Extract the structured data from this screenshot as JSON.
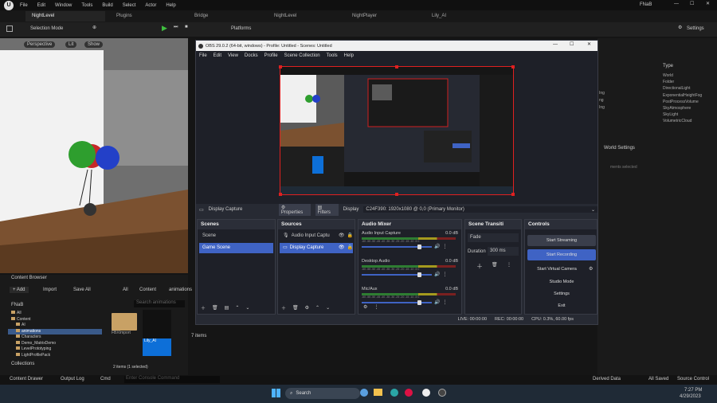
{
  "ue": {
    "menu": [
      "File",
      "Edit",
      "Window",
      "Tools",
      "Build",
      "Select",
      "Actor",
      "Help"
    ],
    "project": "FNaB",
    "tabs": [
      "NightLevel",
      "Plugins",
      "Bridge",
      "NightLevel",
      "NightPlayer",
      "Lily_AI"
    ],
    "toolbar": {
      "selection_mode": "Selection Mode",
      "platforms": "Platforms",
      "settings": "Settings"
    },
    "viewport": {
      "perspective": "Perspective",
      "lit": "Lit",
      "show": "Show"
    },
    "content_browser": {
      "title": "Content Browser",
      "add": "+ Add",
      "import": "Import",
      "save_all": "Save All",
      "path": [
        "All",
        "Content",
        "animations"
      ],
      "tree_root": "FNaB",
      "tree": [
        "All",
        "Content",
        "AI",
        "animations",
        "Characters",
        "Demo_MatrixDemo",
        "LevelPrototyping",
        "LightProfilePack"
      ],
      "filter_placeholder": "Search animations",
      "assets": [
        {
          "name": "FBXImport",
          "type": "folder"
        },
        {
          "name": "Lily_AI",
          "type": "asset"
        }
      ],
      "count": "2 items (1 selected)",
      "collections": "Collections"
    },
    "outliner": {
      "type_header": "Type",
      "types": [
        "World",
        "Folder",
        "DirectionalLight",
        "ExponentialHeightFog",
        "PostProcessVolume",
        "SkyAtmosphere",
        "SkyLight",
        "VolumetricCloud"
      ],
      "world_settings": "World Settings",
      "frag1": "Ing",
      "frag2": "ng",
      "frag3": "Ing",
      "frag4": "ments selected"
    },
    "status": {
      "drawer": "Content Drawer",
      "output_log": "Output Log",
      "cmd": "Cmd",
      "cmd_placeholder": "Enter Console Command",
      "derived_data": "Derived Data",
      "all_saved": "All Saved",
      "source_control": "Source Control"
    },
    "items": "7 items"
  },
  "obs": {
    "title": "OBS 29.0.2 (64-bit, windows) - Profile: Untitled - Scenes: Untitled",
    "menu": [
      "File",
      "Edit",
      "View",
      "Docks",
      "Profile",
      "Scene Collection",
      "Tools",
      "Help"
    ],
    "source_bar": {
      "name": "Display Capture",
      "properties": "Properties",
      "filters": "Filters",
      "display_label": "Display",
      "display_value": "C24F390: 1920x1080 @ 0,0 (Primary Monitor)"
    },
    "scenes": {
      "title": "Scenes",
      "items": [
        "Scene",
        "Game Scene"
      ],
      "selected": 1
    },
    "sources": {
      "title": "Sources",
      "items": [
        "Audio Input Captu",
        "Display Capture"
      ],
      "selected": 1
    },
    "mixer": {
      "title": "Audio Mixer",
      "channels": [
        {
          "name": "Audio Input Capture",
          "db": "0.0 dB",
          "level": 0.82
        },
        {
          "name": "Desktop Audio",
          "db": "0.0 dB",
          "level": 0.82
        },
        {
          "name": "Mic/Aux",
          "db": "0.0 dB",
          "level": 0.82
        }
      ],
      "scale": "-60 -55 -50 -45 -40 -35 -30 -25 -20 -15 -10 -5 0"
    },
    "transitions": {
      "title": "Scene Transiti",
      "type": "Fade",
      "duration_label": "Duration",
      "duration": "300 ms"
    },
    "controls": {
      "title": "Controls",
      "buttons": [
        "Start Streaming",
        "Start Recording",
        "Start Virtual Camera",
        "Studio Mode",
        "Settings",
        "Exit"
      ]
    },
    "status": {
      "live": "LIVE: 00:00:00",
      "rec": "REC: 00:00:00",
      "cpu": "CPU: 0.3%, 60.00 fps"
    }
  },
  "taskbar": {
    "search": "Search",
    "time": "7:27 PM",
    "date": "4/29/2023"
  }
}
